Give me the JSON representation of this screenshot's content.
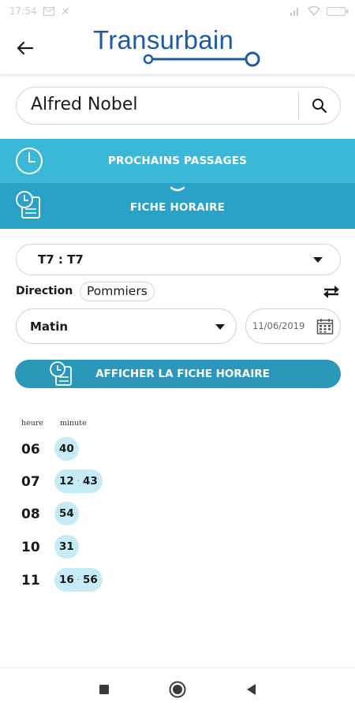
{
  "status_bar": {
    "time": "17:54"
  },
  "header": {
    "logo_text": "Transurbain",
    "brand_color": "#1d5ba6",
    "back_icon": "arrow-left-icon"
  },
  "search": {
    "value": "Alfred Nobel",
    "icon": "search-icon"
  },
  "tabs": [
    {
      "label": "PROCHAINS PASSAGES",
      "icon": "clock-icon",
      "color": "#3bb7d8"
    },
    {
      "label": "FICHE HORAIRE",
      "icon": "schedule-icon",
      "color": "#2aa2c7",
      "active": true
    }
  ],
  "form": {
    "line_value": "T7 : T7",
    "direction_label": "Direction",
    "direction_value": "Pommiers",
    "period_value": "Matin",
    "date_value": "11/06/2019",
    "submit_label": "AFFICHER LA FICHE HORAIRE",
    "submit_color": "#2b97b9"
  },
  "timetable": {
    "hour_header": "heure",
    "minute_header": "minute",
    "highlight_color": "#c4ebf6",
    "rows": [
      {
        "hour": "06",
        "minutes": [
          "40"
        ]
      },
      {
        "hour": "07",
        "minutes": [
          "12",
          "43"
        ]
      },
      {
        "hour": "08",
        "minutes": [
          "54"
        ]
      },
      {
        "hour": "10",
        "minutes": [
          "31"
        ]
      },
      {
        "hour": "11",
        "minutes": [
          "16",
          "56"
        ]
      }
    ]
  },
  "nav": {
    "icons": [
      "recents-icon",
      "home-icon",
      "back-triangle-icon"
    ]
  }
}
